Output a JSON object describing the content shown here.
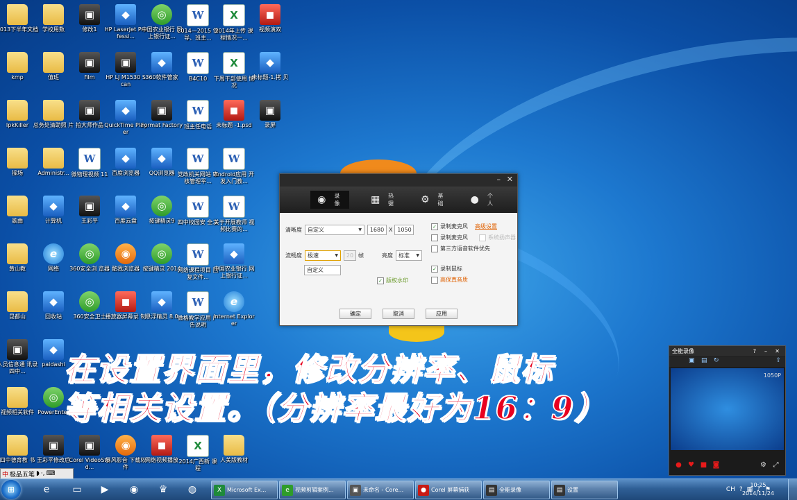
{
  "desktop_icons": [
    {
      "label": "2013下半年文档",
      "kind": "folder",
      "col": 0,
      "row": 0
    },
    {
      "label": "学校用数",
      "kind": "folder",
      "col": 1,
      "row": 0
    },
    {
      "label": "修改1",
      "kind": "dark",
      "col": 2,
      "row": 0
    },
    {
      "label": "HP LaserJet Professi...",
      "kind": "app",
      "col": 3,
      "row": 0
    },
    {
      "label": "中国农业银行 网上银行证...",
      "kind": "green",
      "col": 4,
      "row": 0
    },
    {
      "label": "2014—2015 领导、班主...",
      "kind": "doc",
      "col": 5,
      "row": 0
    },
    {
      "label": "2014年上传 课程情况一...",
      "kind": "xls",
      "col": 6,
      "row": 0
    },
    {
      "label": "视频演双",
      "kind": "red",
      "col": 7,
      "row": 0
    },
    {
      "label": "kmp",
      "kind": "folder",
      "col": 0,
      "row": 1
    },
    {
      "label": "值班",
      "kind": "folder",
      "col": 1,
      "row": 1
    },
    {
      "label": "film",
      "kind": "dark",
      "col": 2,
      "row": 1
    },
    {
      "label": "HP LJ M1530 Scan",
      "kind": "dark",
      "col": 3,
      "row": 1
    },
    {
      "label": "360软件管家",
      "kind": "app",
      "col": 4,
      "row": 1
    },
    {
      "label": "B4C10",
      "kind": "doc",
      "col": 5,
      "row": 1
    },
    {
      "label": "下周干部使用 情况",
      "kind": "xls",
      "col": 6,
      "row": 1
    },
    {
      "label": "未标题-1.拷 贝",
      "kind": "app",
      "col": 7,
      "row": 1
    },
    {
      "label": "IpkKiller",
      "kind": "folder",
      "col": 0,
      "row": 2
    },
    {
      "label": "总务处清助照 片",
      "kind": "folder",
      "col": 1,
      "row": 2
    },
    {
      "label": "拍大师作品",
      "kind": "dark",
      "col": 2,
      "row": 2
    },
    {
      "label": "QuickTime Player",
      "kind": "app",
      "col": 3,
      "row": 2
    },
    {
      "label": "Format Factory",
      "kind": "dark",
      "col": 4,
      "row": 2
    },
    {
      "label": "班主任电话",
      "kind": "doc",
      "col": 5,
      "row": 2
    },
    {
      "label": "未标题 -1.psd",
      "kind": "red",
      "col": 6,
      "row": 2
    },
    {
      "label": "录屏",
      "kind": "dark",
      "col": 7,
      "row": 2
    },
    {
      "label": "操场",
      "kind": "folder",
      "col": 0,
      "row": 3
    },
    {
      "label": "Administr...",
      "kind": "folder",
      "col": 1,
      "row": 3
    },
    {
      "label": "微物理视频 11",
      "kind": "doc",
      "col": 2,
      "row": 3
    },
    {
      "label": "百度浏览器",
      "kind": "app",
      "col": 3,
      "row": 3
    },
    {
      "label": "QQ浏览器",
      "kind": "app",
      "col": 4,
      "row": 3
    },
    {
      "label": "党政机关网站 审核管理平...",
      "kind": "doc",
      "col": 5,
      "row": 3
    },
    {
      "label": "Android应用 开发入门教...",
      "kind": "doc",
      "col": 6,
      "row": 3
    },
    {
      "label": "歌曲",
      "kind": "folder",
      "col": 0,
      "row": 4
    },
    {
      "label": "计算机",
      "kind": "app",
      "col": 1,
      "row": 4
    },
    {
      "label": "王彩平",
      "kind": "dark",
      "col": 2,
      "row": 4
    },
    {
      "label": "百度云盘",
      "kind": "app",
      "col": 3,
      "row": 4
    },
    {
      "label": "按键精灵9",
      "kind": "green",
      "col": 4,
      "row": 4
    },
    {
      "label": "四中校园安 全工",
      "kind": "doc",
      "col": 5,
      "row": 4
    },
    {
      "label": "关于开展教师 视频比赛的...",
      "kind": "doc",
      "col": 6,
      "row": 4
    },
    {
      "label": "黄山教",
      "kind": "folder",
      "col": 0,
      "row": 5
    },
    {
      "label": "网络",
      "kind": "ie",
      "col": 1,
      "row": 5
    },
    {
      "label": "360安全浏 览器",
      "kind": "green",
      "col": 2,
      "row": 5
    },
    {
      "label": "酷我浏览器",
      "kind": "orange",
      "col": 3,
      "row": 5
    },
    {
      "label": "按键精灵 2014",
      "kind": "green",
      "col": 4,
      "row": 5
    },
    {
      "label": "网络课程项目 回复文件...",
      "kind": "doc",
      "col": 5,
      "row": 5
    },
    {
      "label": "中国农业银行 网上银行证...",
      "kind": "app",
      "col": 6,
      "row": 5
    },
    {
      "label": "昆都山",
      "kind": "folder",
      "col": 0,
      "row": 6
    },
    {
      "label": "回收站",
      "kind": "app",
      "col": 1,
      "row": 6
    },
    {
      "label": "360安全卫士",
      "kind": "green",
      "col": 2,
      "row": 6
    },
    {
      "label": "播放器屏幕录 制",
      "kind": "red",
      "col": 3,
      "row": 6
    },
    {
      "label": "悬浮精灵 8.0",
      "kind": "app",
      "col": 4,
      "row": 6
    },
    {
      "label": "微格教学应用 广告说明",
      "kind": "doc",
      "col": 5,
      "row": 6
    },
    {
      "label": "Internet Explorer",
      "kind": "ie",
      "col": 6,
      "row": 6
    },
    {
      "label": "人员信息通 讯录四中...",
      "kind": "dark",
      "col": 0,
      "row": 7
    },
    {
      "label": "paidashi",
      "kind": "app",
      "col": 1,
      "row": 7
    },
    {
      "label": "视频相关软件",
      "kind": "folder",
      "col": 0,
      "row": 8
    },
    {
      "label": "PowerEnter",
      "kind": "green",
      "col": 1,
      "row": 8
    },
    {
      "label": "四中德育教 书",
      "kind": "folder",
      "col": 0,
      "row": 9
    },
    {
      "label": "王彩平修改后",
      "kind": "dark",
      "col": 1,
      "row": 9
    },
    {
      "label": "Corel VideoStud...",
      "kind": "dark",
      "col": 2,
      "row": 9
    },
    {
      "label": "暴风影音 下载软件",
      "kind": "orange",
      "col": 3,
      "row": 9
    },
    {
      "label": "网络视频播放",
      "kind": "red",
      "col": 4,
      "row": 9
    },
    {
      "label": "2014广西新 课程",
      "kind": "xls",
      "col": 5,
      "row": 9
    },
    {
      "label": "人美版教材",
      "kind": "folder",
      "col": 6,
      "row": 9
    }
  ],
  "dialog": {
    "tabs": [
      {
        "label": "录像",
        "icon": "film-reel-icon",
        "glyph": "◉"
      },
      {
        "label": "热键",
        "icon": "hotkey-icon",
        "glyph": "▦"
      },
      {
        "label": "基础",
        "icon": "gear-icon",
        "glyph": "⚙"
      },
      {
        "label": "个人",
        "icon": "user-icon",
        "glyph": "●"
      }
    ],
    "resolution_label": "清晰度",
    "resolution_value": "自定义",
    "width_value": "1680",
    "x_label": "X",
    "height_value": "1050",
    "fluency_label": "流畅度",
    "fluency_value": "极速",
    "fluency_option": "自定义",
    "fps_placeholder": "20",
    "fps_unit": "帧",
    "brightness_label": "亮度",
    "brightness_value": "标准",
    "watermark_label": "版权水印",
    "opt_record_audio": "录制麦克风",
    "opt_speaker": "录制扬声器",
    "opt_advanced_link": "高级设置",
    "opt_mic": "录制麦克风",
    "opt_system_audio": "系统扬声器",
    "opt_third_party": "第三方语音软件优先",
    "opt_cursor": "录制鼠标",
    "opt_high_quality": "高保真音质",
    "btn_ok": "确定",
    "btn_cancel": "取消",
    "btn_apply": "应用"
  },
  "caption": {
    "line1": "在设置界面里，修改分辨率、鼠标",
    "line2": "等相关设置。（分辨率最好为16：9）"
  },
  "recorder": {
    "title": "全能录像",
    "resolution": "1050P"
  },
  "ime": {
    "label": "极品五笔"
  },
  "taskbar": {
    "windows": [
      {
        "label": "Microsoft Ex...",
        "color": "#1e8a3a",
        "glyph": "X"
      },
      {
        "label": "视频剪辑案例...",
        "color": "#2f9c2a",
        "glyph": "e"
      },
      {
        "label": "未命名 - Core...",
        "color": "#555555",
        "glyph": "▣"
      },
      {
        "label": "Corel 屏幕捕获",
        "color": "#c81a14",
        "glyph": "●"
      },
      {
        "label": "全能录像",
        "color": "#333333",
        "glyph": "▤"
      },
      {
        "label": "设置",
        "color": "#333333",
        "glyph": "▤"
      }
    ],
    "time": "10:25",
    "date": "2014/11/24",
    "tray_lang": "CH"
  },
  "colors": {
    "caption": "#e8001f",
    "accent_link": "#e06000",
    "check_green": "#2a8a2a"
  }
}
